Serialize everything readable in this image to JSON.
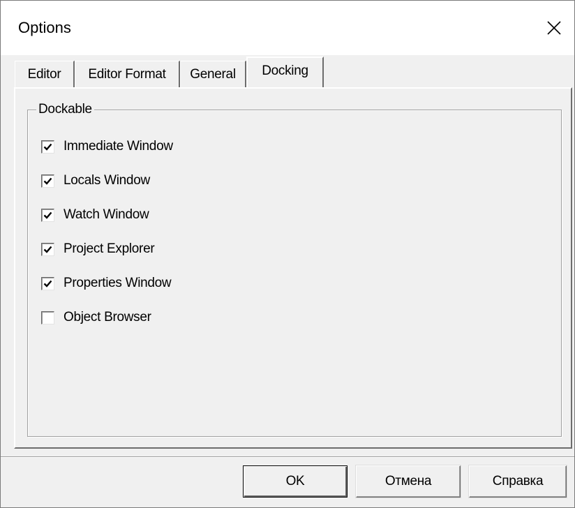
{
  "window": {
    "title": "Options"
  },
  "tabs": [
    {
      "label": "Editor"
    },
    {
      "label": "Editor Format"
    },
    {
      "label": "General"
    },
    {
      "label": "Docking"
    }
  ],
  "selected_tab": "Docking",
  "group": {
    "title": "Dockable",
    "items": [
      {
        "label": "Immediate Window",
        "checked": true
      },
      {
        "label": "Locals Window",
        "checked": true
      },
      {
        "label": "Watch Window",
        "checked": true
      },
      {
        "label": "Project Explorer",
        "checked": true
      },
      {
        "label": "Properties Window",
        "checked": true
      },
      {
        "label": "Object Browser",
        "checked": false
      }
    ]
  },
  "buttons": {
    "ok": "OK",
    "cancel": "Отмена",
    "help": "Справка"
  }
}
